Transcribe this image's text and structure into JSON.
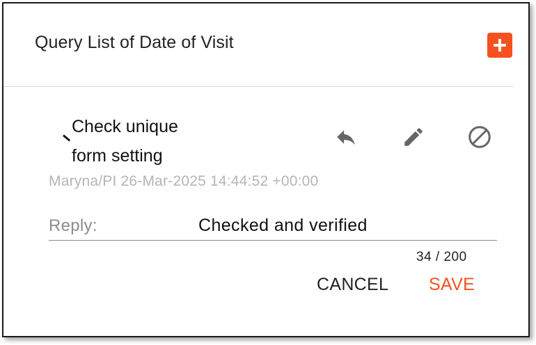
{
  "dialog": {
    "title": "Query List of Date of Visit",
    "add_icon": "plus-icon"
  },
  "query": {
    "text": "Check unique form setting",
    "meta": "Maryna/PI 26-Mar-2025 14:44:52 +00:00",
    "actions": {
      "reply_icon": "reply-icon",
      "edit_icon": "pencil-icon",
      "close_icon": "circle-slash-icon"
    }
  },
  "reply": {
    "label": "Reply:",
    "value": "Checked and verified",
    "char_count": "34 / 200"
  },
  "buttons": {
    "cancel_label": "CANCEL",
    "save_label": "SAVE"
  },
  "colors": {
    "accent": "#f4511e",
    "icon_gray": "#666666",
    "meta_text": "#b5b5b5"
  }
}
